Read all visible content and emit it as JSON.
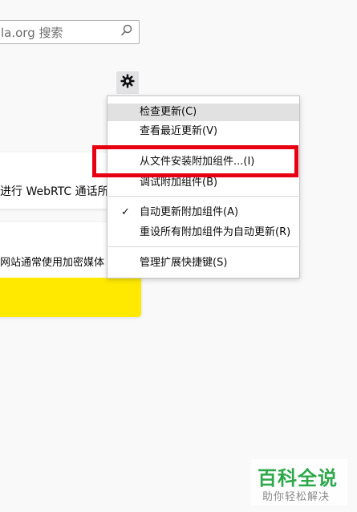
{
  "search": {
    "text": "la.org 搜索",
    "icon": "search-icon"
  },
  "tools_button": {
    "icon": "gear-icon"
  },
  "cards": [
    {
      "text": "进行 WebRTC 通话所需"
    },
    {
      "text": "网站通常使用加密媒体"
    }
  ],
  "menu": {
    "items": [
      {
        "label": "检查更新(C)",
        "checked": false
      },
      {
        "label": "查看最近更新(V)",
        "checked": false
      },
      {
        "label": "从文件安装附加组件...(I)",
        "checked": false
      },
      {
        "label": "调试附加组件(B)",
        "checked": false
      },
      {
        "label": "自动更新附加组件(A)",
        "checked": true,
        "check_mark": "✓"
      },
      {
        "label": "重设所有附加组件为自动更新(R)",
        "checked": false
      },
      {
        "label": "管理扩展快捷键(S)",
        "checked": false
      }
    ]
  },
  "watermark": {
    "title": "百科全说",
    "subtitle": "助你轻松解决"
  },
  "colors": {
    "highlight": "#e60012",
    "yellow_band": "#ffe900",
    "watermark_green": "#2ea84a"
  }
}
